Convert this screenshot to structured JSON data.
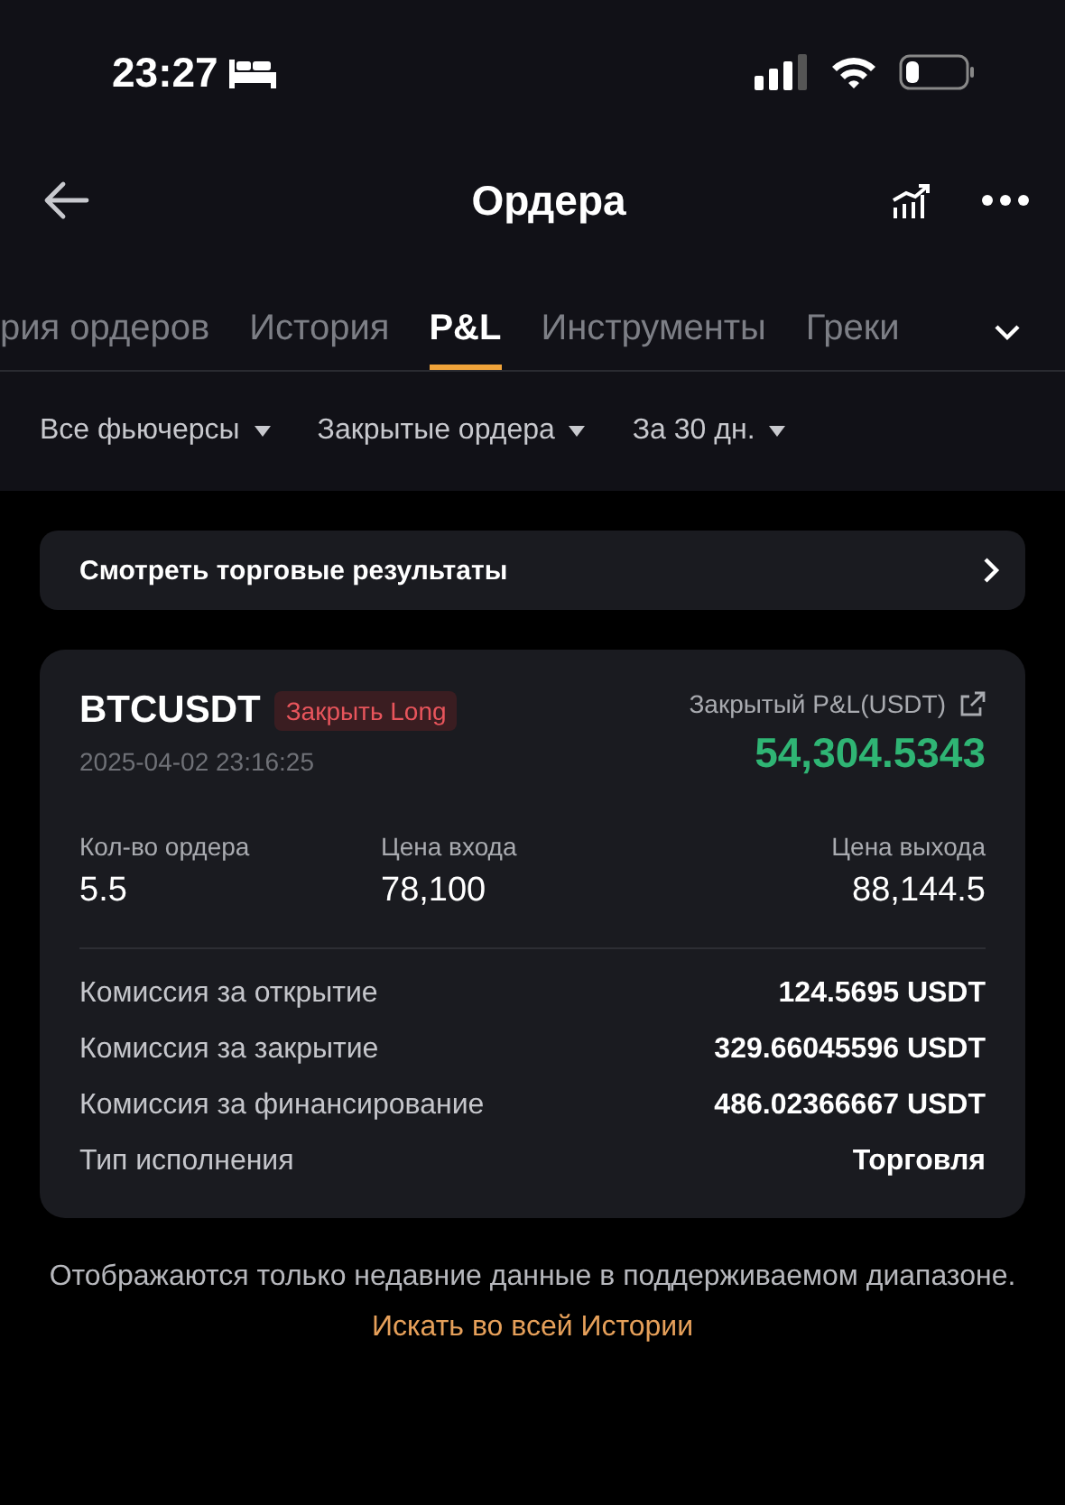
{
  "status_bar": {
    "time": "23:27"
  },
  "header": {
    "title": "Ордера"
  },
  "tabs": [
    {
      "label": "рия ордеров",
      "selected": false
    },
    {
      "label": "История",
      "selected": false
    },
    {
      "label": "P&L",
      "selected": true
    },
    {
      "label": "Инструменты",
      "selected": false
    },
    {
      "label": "Греки",
      "selected": false
    }
  ],
  "filters": [
    {
      "label": "Все фьючерсы"
    },
    {
      "label": "Закрытые ордера"
    },
    {
      "label": "За 30 дн."
    }
  ],
  "results_link": {
    "label": "Смотреть торговые результаты"
  },
  "order": {
    "symbol": "BTCUSDT",
    "side_tag": "Закрыть Long",
    "timestamp": "2025-04-02 23:16:25",
    "pnl_label": "Закрытый P&L(USDT)",
    "pnl_value": "54,304.5343",
    "stats": [
      {
        "label": "Кол-во ордера",
        "value": "5.5"
      },
      {
        "label": "Цена входа",
        "value": "78,100"
      },
      {
        "label": "Цена выхода",
        "value": "88,144.5"
      }
    ],
    "details": [
      {
        "label": "Комиссия за открытие",
        "value": "124.5695 USDT"
      },
      {
        "label": "Комиссия за закрытие",
        "value": "329.66045596 USDT"
      },
      {
        "label": "Комиссия за финансирование",
        "value": "486.02366667 USDT"
      },
      {
        "label": "Тип исполнения",
        "value": "Торговля"
      }
    ]
  },
  "footer": {
    "note": "Отображаются только недавние данные в поддерживаемом диапазоне.",
    "link": "Искать во всей Истории"
  }
}
